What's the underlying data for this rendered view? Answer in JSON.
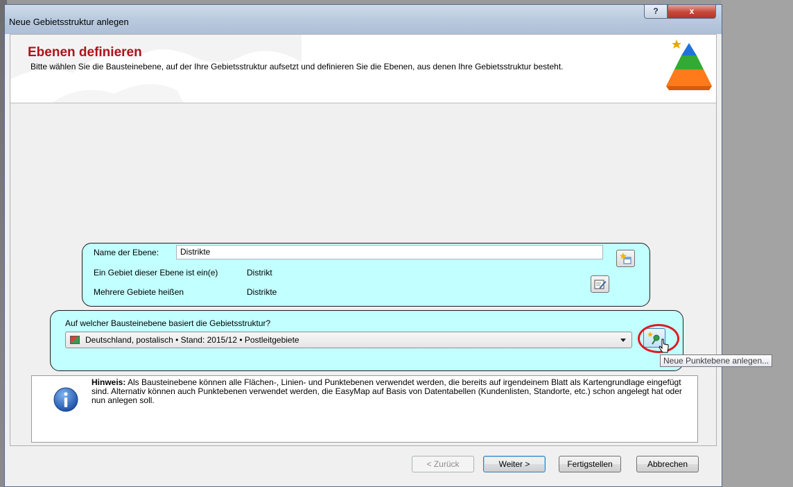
{
  "window": {
    "title": "Neue Gebietsstruktur anlegen",
    "help_label": "?",
    "close_label": "x"
  },
  "header": {
    "title": "Ebenen definieren",
    "description": "Bitte wählen Sie die Bausteinebene, auf der Ihre Gebietsstruktur aufsetzt und definieren Sie die Ebenen, aus denen Ihre Gebietsstruktur besteht."
  },
  "level": {
    "name_label": "Name der Ebene:",
    "name_value": "Distrikte",
    "singular_label": "Ein Gebiet dieser Ebene ist ein(e)",
    "singular_value": "Distrikt",
    "plural_label": "Mehrere Gebiete heißen",
    "plural_value": "Distrikte"
  },
  "base": {
    "question": "Auf welcher Bausteinebene basiert die Gebietsstruktur?",
    "selected": "Deutschland, postalisch • Stand: 2015/12 • Postleitgebiete",
    "tooltip": "Neue Punktebene anlegen..."
  },
  "hint": {
    "label": "Hinweis:",
    "text": " Als Bausteinebene können alle Flächen-, Linien- und Punktebenen verwendet werden, die bereits auf irgendeinem Blatt als Kartengrundlage eingefügt sind. Alternativ können auch Punktebenen verwendet werden, die EasyMap auf Basis von Datentabellen (Kundenlisten,  Standorte, etc.) schon angelegt hat oder nun anlegen soll."
  },
  "buttons": {
    "back": "< Zurück",
    "next": "Weiter >",
    "finish": "Fertigstellen",
    "cancel": "Abbrechen"
  }
}
